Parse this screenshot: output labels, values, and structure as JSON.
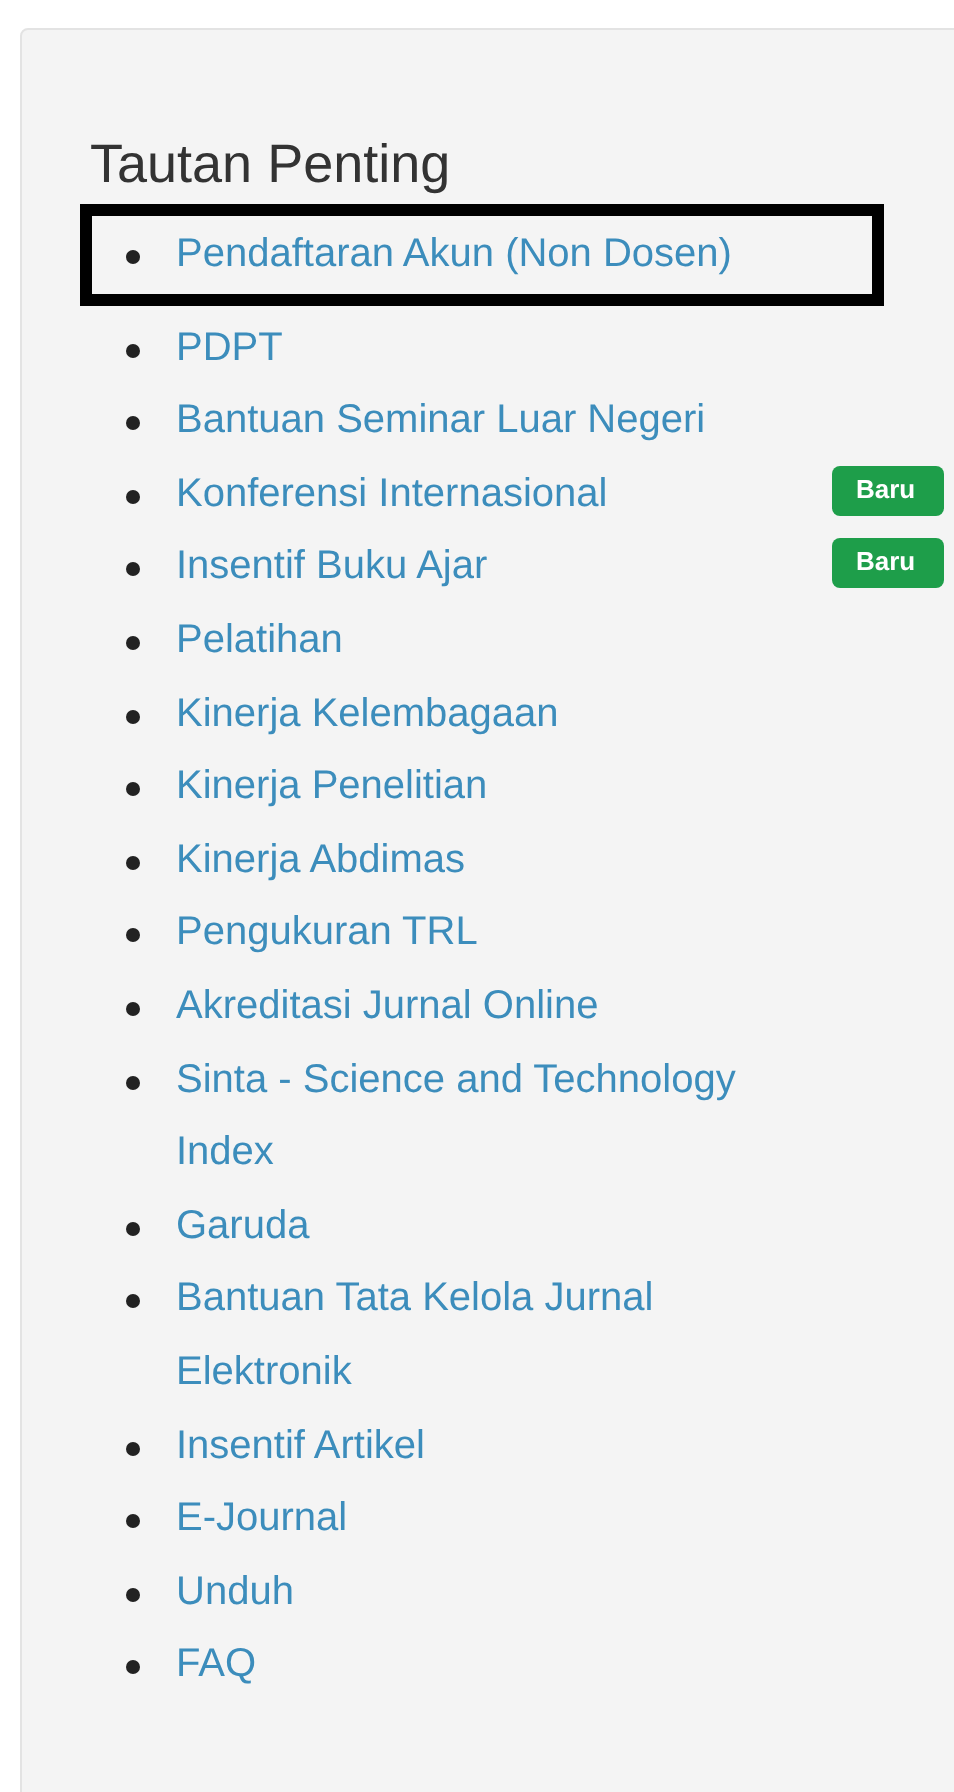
{
  "panel": {
    "title": "Tautan Penting",
    "links": [
      {
        "label": "Pendaftaran Akun (Non Dosen)",
        "highlighted": true
      },
      {
        "label": "PDPT",
        "highlighted": false
      },
      {
        "label": "Bantuan Seminar Luar Negeri",
        "highlighted": false
      },
      {
        "label": "Konferensi Internasional",
        "highlighted": false,
        "badge": "Baru"
      },
      {
        "label": "Insentif Buku Ajar",
        "highlighted": false,
        "badge": "Baru"
      },
      {
        "label": "Pelatihan",
        "highlighted": false
      },
      {
        "label": "Kinerja Kelembagaan",
        "highlighted": false
      },
      {
        "label": "Kinerja Penelitian",
        "highlighted": false
      },
      {
        "label": "Kinerja Abdimas",
        "highlighted": false
      },
      {
        "label": "Pengukuran TRL",
        "highlighted": false
      },
      {
        "label": "Akreditasi Jurnal Online",
        "highlighted": false
      },
      {
        "label": "Sinta - Science and Technology Index",
        "highlighted": false
      },
      {
        "label": "Garuda",
        "highlighted": false
      },
      {
        "label": "Bantuan Tata Kelola Jurnal Elektronik",
        "highlighted": false
      },
      {
        "label": "Insentif Artikel",
        "highlighted": false
      },
      {
        "label": "E-Journal",
        "highlighted": false
      },
      {
        "label": "Unduh",
        "highlighted": false
      },
      {
        "label": "FAQ",
        "highlighted": false
      }
    ]
  }
}
